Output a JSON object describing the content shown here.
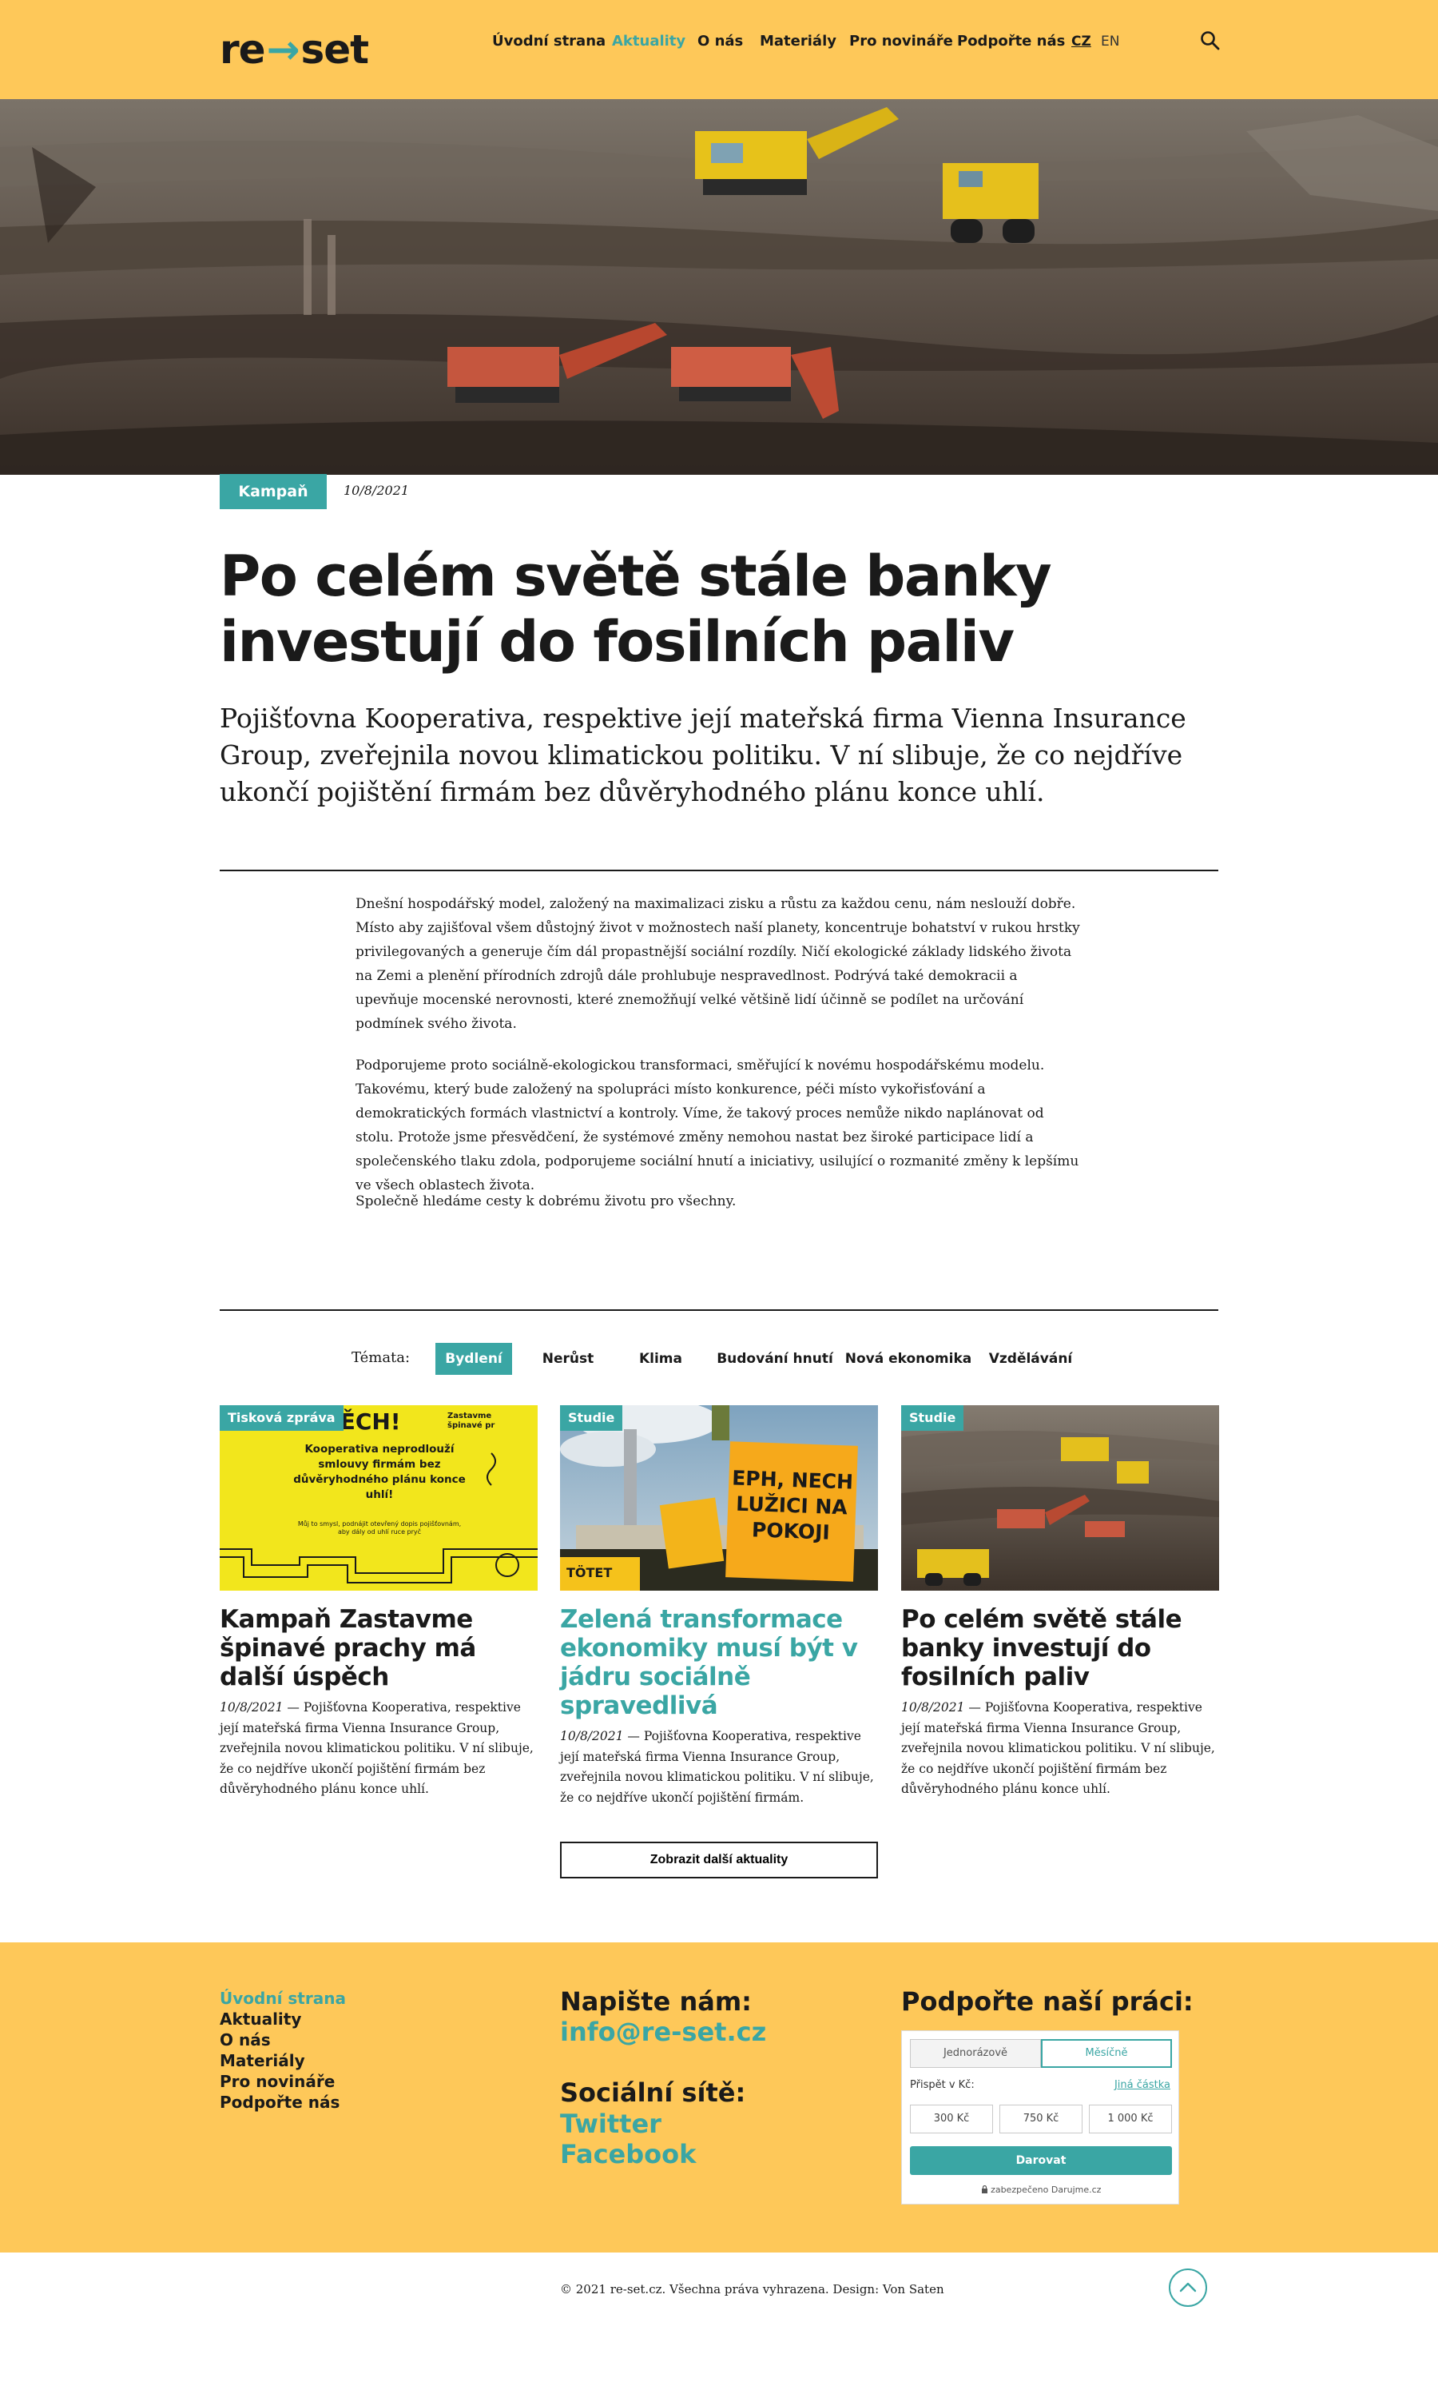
{
  "header": {
    "logo_left": "re",
    "logo_arrow": "→",
    "logo_right": "set",
    "nav": [
      {
        "label": "Úvodní strana"
      },
      {
        "label": "Aktuality"
      },
      {
        "label": "O nás"
      },
      {
        "label": "Materiály"
      },
      {
        "label": "Pro novináře"
      },
      {
        "label": "Podpořte nás"
      }
    ],
    "lang_cz": "CZ",
    "lang_en": "EN",
    "search_icon": "search-icon"
  },
  "article": {
    "tag": "Kampaň",
    "date": "10/8/2021",
    "title_line1": "Po celém světě stále banky",
    "title_line2": "investují do fosilních paliv",
    "lead": "Pojišťovna Kooperativa, respektive její mateřská firma Vienna Insurance Group, zveřejnila novou klimatickou politiku. V ní slibuje, že co nejdříve ukončí pojištění firmám bez důvěryhodného plánu konce uhlí.",
    "paragraphs": [
      "Dnešní hospodářský model, založený na maximalizaci zisku a růstu za každou cenu, nám neslouží dobře. Místo aby zajišťoval všem důstojný život v možnostech naší planety, koncentruje bohatství v rukou hrstky privilegovaných a generuje čím dál propastnější sociální rozdíly. Ničí ekologické základy lidského života na Zemi a plenění přírodních zdrojů dále prohlubuje nespravedlnost. Podrývá také demokracii a upevňuje mocenské nerovnosti, které znemožňují velké většině lidí účinně se podílet na určování podmínek svého života.",
      "Podporujeme proto sociálně-ekologickou transformaci, směřující k novému hospodářskému modelu. Takovému, který bude založený na spolupráci místo konkurence, péči místo vykořisťování a demokratických formách vlastnictví a kontroly. Víme, že takový proces nemůže nikdo naplánovat od stolu. Protože jsme přesvědčení, že systémové změny nemohou nastat bez široké participace lidí a společenského tlaku zdola, podporujeme sociální hnutí a iniciativy, usilující o rozmanité změny k lepšímu ve všech oblastech života.",
      "Společně hledáme cesty k dobrému životu pro všechny."
    ]
  },
  "topics": {
    "label": "Témata:",
    "items": [
      "Bydlení",
      "Nerůst",
      "Klima",
      "Budování hnutí",
      "Nová ekonomika",
      "Vzdělávání"
    ]
  },
  "cards": [
    {
      "badge": "Tisková zpráva",
      "poster_head": "SPĚCH!",
      "poster_text": "Kooperativa neprodlouží smlouvy firmám bez důvěryhodného plánu konce uhlí!",
      "poster_small": "Můj to smysl, podnájit otevřený dopis pojišťovnám, aby dály od uhlí ruce pryč",
      "poster_corner": "Zastavme špinavé pr",
      "title": "Kampaň Zastavme špinavé prachy má další úspěch",
      "date": "10/8/2021",
      "text": "— Pojišťovna Kooperativa, respektive její mateřská firma Vienna Insurance Group, zveřejnila novou klimatickou politiku. V ní slibuje, že co nejdříve ukončí pojištění firmám bez důvěryhodného plánu konce uhlí."
    },
    {
      "badge": "Studie",
      "sign_text": "EPH, NECH LUŽICI NA POKOJI",
      "banner_text": "TÖTET",
      "title": "Zelená transformace ekonomiky musí být v jádru sociálně spravedlivá",
      "date": "10/8/2021",
      "text": "— Pojišťovna Kooperativa, respektive její mateřská firma Vienna Insurance Group, zveřejnila novou klimatickou politiku. V ní slibuje, že co nejdříve ukončí pojištění firmám."
    },
    {
      "badge": "Studie",
      "title": "Po celém světě stále banky investují do fosilních paliv",
      "date": "10/8/2021",
      "text": "— Pojišťovna Kooperativa, respektive její mateřská firma Vienna Insurance Group, zveřejnila novou klimatickou politiku. V ní slibuje, že co nejdříve ukončí pojištění firmám bez důvěryhodného plánu konce uhlí."
    }
  ],
  "more_button": "Zobrazit další aktuality",
  "footer": {
    "links": [
      "Úvodní strana",
      "Aktuality",
      "O nás",
      "Materiály",
      "Pro novináře",
      "Podpořte nás"
    ],
    "write_title": "Napište nám:",
    "email": "info@re-set.cz",
    "social_title": "Sociální sítě:",
    "twitter": "Twitter",
    "facebook": "Facebook",
    "support_title": "Podpořte naší práci:",
    "donate": {
      "tab_once": "Jednorázově",
      "tab_monthly": "Měsíčně",
      "label": "Přispět v Kč:",
      "other": "Jiná částka",
      "amounts": [
        "300 Kč",
        "750 Kč",
        "1 000 Kč"
      ],
      "submit": "Darovat",
      "secure": "zabezpečeno Darujme.cz"
    },
    "copyright": "© 2021 re-set.cz. Všechna práva vyhrazena. Design: Von Saten"
  },
  "colors": {
    "accent": "#3aa6a4",
    "brand_yellow": "#fec859",
    "poster_yellow": "#f2e61c",
    "text": "#1a1a1a"
  }
}
